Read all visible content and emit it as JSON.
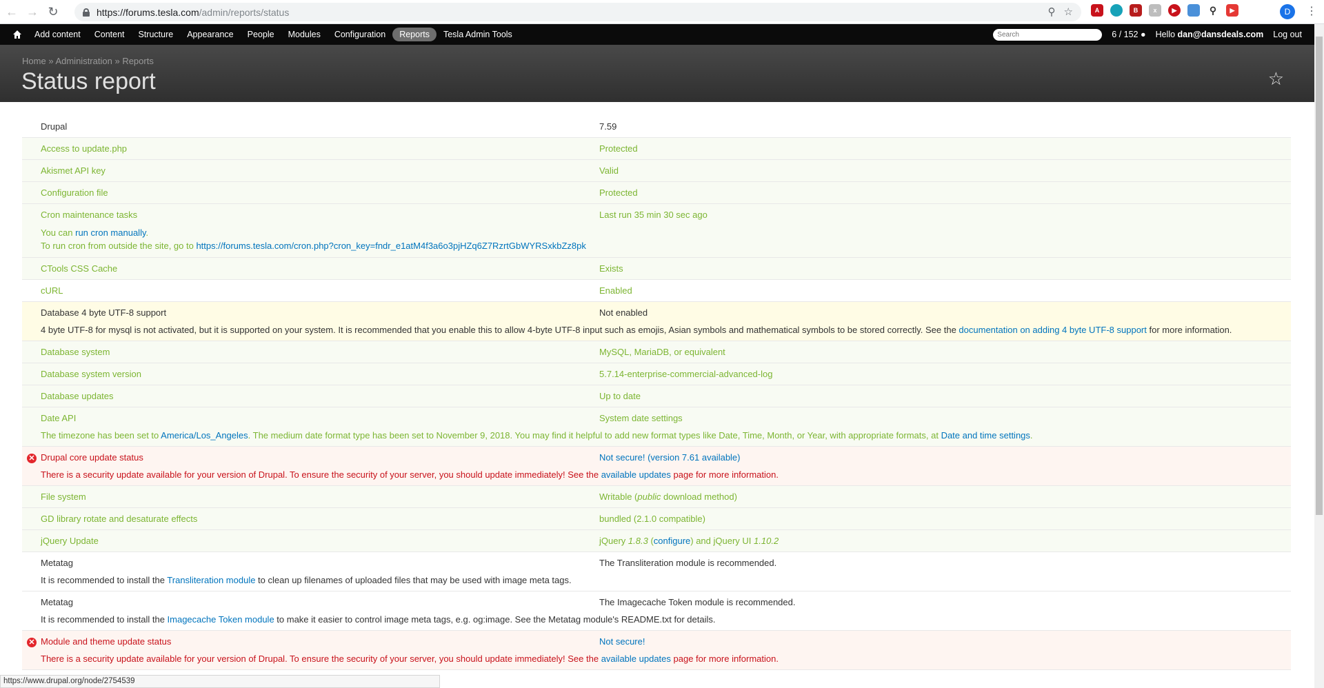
{
  "browser": {
    "url_host": "https://forums.tesla.com",
    "url_path": "/admin/reports/status",
    "avatar_letter": "D"
  },
  "toolbar": {
    "items": [
      "Add content",
      "Content",
      "Structure",
      "Appearance",
      "People",
      "Modules",
      "Configuration",
      "Reports",
      "Tesla Admin Tools"
    ],
    "active_item": "Reports",
    "search_placeholder": "Search",
    "counter": "6 / 152",
    "hello": "Hello",
    "user": "dan@dansdeals.com",
    "logout": "Log out"
  },
  "header": {
    "breadcrumb": [
      "Home",
      "Administration",
      "Reports"
    ],
    "breadcrumb_sep": "»",
    "title": "Status report"
  },
  "rows": {
    "drupal": {
      "title": "Drupal",
      "value": "7.59"
    },
    "access": {
      "title": "Access to update.php",
      "value": "Protected"
    },
    "akismet": {
      "title": "Akismet API key",
      "value": "Valid"
    },
    "config": {
      "title": "Configuration file",
      "value": "Protected"
    },
    "cron": {
      "title": "Cron maintenance tasks",
      "value": "Last run 35 min 30 sec ago",
      "desc1_pre": "You can ",
      "desc1_link": "run cron manually",
      "desc1_post": ".",
      "desc2_pre": "To run cron from outside the site, go to ",
      "desc2_link": "https://forums.tesla.com/cron.php?cron_key=fndr_e1atM4f3a6o3pjHZq6Z7RzrtGbWYRSxkbZz8pk"
    },
    "ctools": {
      "title": "CTools CSS Cache",
      "value": "Exists"
    },
    "curl": {
      "title": "cURL",
      "value": "Enabled"
    },
    "utf8": {
      "title": "Database 4 byte UTF-8 support",
      "value": "Not enabled",
      "desc_pre": "4 byte UTF-8 for mysql is not activated, but it is supported on your system. It is recommended that you enable this to allow 4-byte UTF-8 input such as emojis, Asian symbols and mathematical symbols to be stored correctly. See the ",
      "desc_link": "documentation on adding 4 byte UTF-8 support",
      "desc_post": " for more information."
    },
    "dbsystem": {
      "title": "Database system",
      "value": "MySQL, MariaDB, or equivalent"
    },
    "dbversion": {
      "title": "Database system version",
      "value": "5.7.14-enterprise-commercial-advanced-log"
    },
    "dbupdates": {
      "title": "Database updates",
      "value": "Up to date"
    },
    "dateapi": {
      "title": "Date API",
      "value": "System date settings",
      "desc_pre": "The timezone has been set to ",
      "desc_link1": "America/Los_Angeles",
      "desc_mid": ". The medium date format type has been set to November 9, 2018. You may find it helpful to add new format types like Date, Time, Month, or Year, with appropriate formats, at ",
      "desc_link2": "Date and time settings",
      "desc_post": "."
    },
    "coreupdate": {
      "title": "Drupal core update status",
      "value": "Not secure! (version 7.61 available)",
      "desc_pre": "There is a security update available for your version of Drupal. To ensure the security of your server, you should update immediately! See the ",
      "desc_link": "available updates",
      "desc_post": " page for more information."
    },
    "filesystem": {
      "title": "File system",
      "value_pre": "Writable (",
      "value_em": "public",
      "value_post": " download method)"
    },
    "gd": {
      "title": "GD library rotate and desaturate effects",
      "value": "bundled (2.1.0 compatible)"
    },
    "jquery": {
      "title": "jQuery Update",
      "v1": "jQuery ",
      "v2": "1.8.3",
      "v3": " (",
      "v4": "configure",
      "v5": ") and jQuery UI ",
      "v6": "1.10.2"
    },
    "metatag1": {
      "title": "Metatag",
      "value": "The Transliteration module is recommended.",
      "desc_pre": "It is recommended to install the ",
      "desc_link": "Transliteration module",
      "desc_post": " to clean up filenames of uploaded files that may be used with image meta tags."
    },
    "metatag2": {
      "title": "Metatag",
      "value": "The Imagecache Token module is recommended.",
      "desc_pre": "It is recommended to install the ",
      "desc_link": "Imagecache Token module",
      "desc_post": " to make it easier to control image meta tags, e.g. og:image. See the Metatag module's README.txt for details."
    },
    "moduleupdate": {
      "title": "Module and theme update status",
      "value": "Not secure!",
      "desc_pre": "There is a security update available for your version of Drupal. To ensure the security of your server, you should update immediately! See the ",
      "desc_link": "available updates",
      "desc_post": " page for more information."
    }
  },
  "statusbar": {
    "text": "https://www.drupal.org/node/2754539"
  }
}
